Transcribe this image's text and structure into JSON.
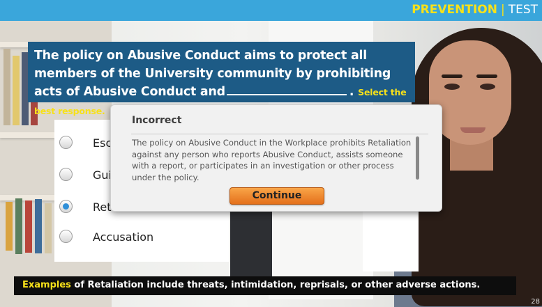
{
  "header": {
    "title_main": "PREVENTION",
    "separator": "|",
    "title_sub": "TEST"
  },
  "question": {
    "text_before": "The policy on Abusive Conduct aims to protect all members of the University community by prohibiting acts of Abusive Conduct and",
    "text_after": ".",
    "instruction": "Select the best response."
  },
  "answers": [
    {
      "label": "Esc",
      "selected": false
    },
    {
      "label": "Gui",
      "selected": false
    },
    {
      "label": "Ret",
      "selected": true
    },
    {
      "label": "Accusation",
      "selected": false
    }
  ],
  "feedback": {
    "title": "Incorrect",
    "body": "The policy on Abusive Conduct in the Workplace prohibits Retaliation against any person who reports Abusive Conduct, assists someone with a report, or participates in an investigation or other process under the policy.",
    "button_label": "Continue"
  },
  "caption": {
    "keyword": "Examples",
    "text": " of Retaliation include threats, intimidation, reprisals, or other adverse actions."
  },
  "page_number": "28",
  "colors": {
    "topbar": "#3aa6db",
    "accent_yellow": "#f7e11a",
    "question_bg": "#1d5b86",
    "button_orange": "#e4701b",
    "radio_selected": "#2f8fd8"
  }
}
